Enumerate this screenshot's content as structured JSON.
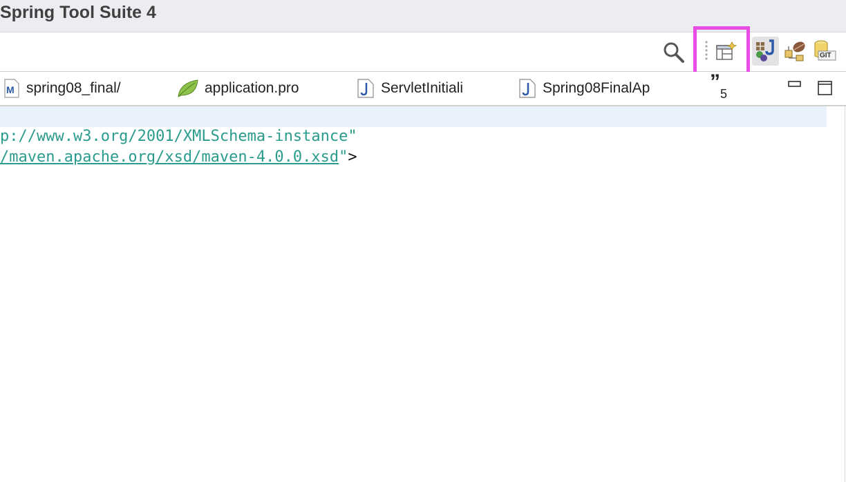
{
  "window": {
    "title": "Spring Tool Suite 4"
  },
  "toolbar": {
    "icons": [
      "search-icon",
      "open-perspective-icon",
      "java-ee-perspective-icon",
      "java-perspective-icon",
      "spring-perspective-icon",
      "git-perspective-icon"
    ],
    "git_label": "GIT",
    "highlight_color": "#e84ee6"
  },
  "tabs": [
    {
      "label": "spring08_final/",
      "icon": "maven-pom-icon"
    },
    {
      "label": "application.pro",
      "icon": "spring-leaf-icon"
    },
    {
      "label": "ServletInitiali",
      "icon": "java-file-icon"
    },
    {
      "label": "Spring08FinalAp",
      "icon": "java-file-icon"
    }
  ],
  "tab_overflow": {
    "glyph": "”",
    "count": "5"
  },
  "editor": {
    "line1": {
      "text": "p://www.w3.org/2001/XMLSchema-instance",
      "quote": "\""
    },
    "line2": {
      "text": "/maven.apache.org/xsd/maven-4.0.0.xsd",
      "quote": "\"",
      "close": ">"
    },
    "current_line_color": "#e8f0fc",
    "string_color": "#2a9b8c"
  }
}
